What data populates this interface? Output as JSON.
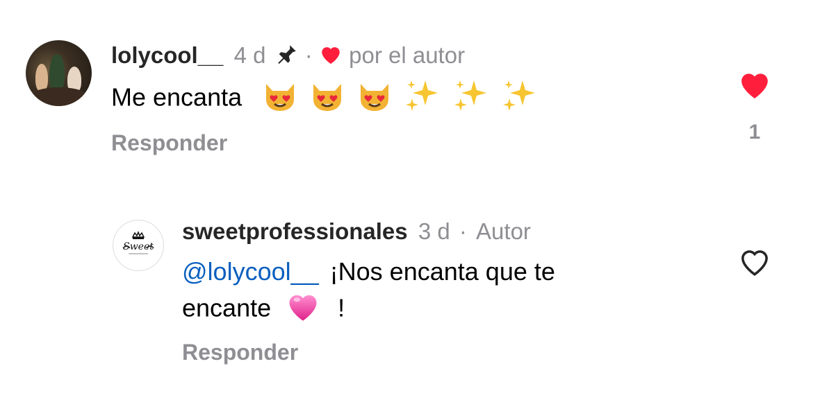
{
  "comments": [
    {
      "username": "lolycool__",
      "time": "4 d",
      "separator": "·",
      "liked_by_author_label": "por el autor",
      "text": "Me encanta",
      "emojis": [
        "heart-eyes-cat",
        "heart-eyes-cat",
        "heart-eyes-cat",
        "sparkles",
        "sparkles",
        "sparkles"
      ],
      "reply_label": "Responder",
      "like_count": "1",
      "liked": true
    },
    {
      "username": "sweetprofessionales",
      "time": "3 d",
      "separator": "·",
      "author_label": "Autor",
      "mention": "@lolycool__",
      "text_line1": "¡Nos encanta que te",
      "text_line2": "encante",
      "text_end": "!",
      "emoji": "pink-heart",
      "reply_label": "Responder",
      "liked": false
    }
  ],
  "colors": {
    "like_red": "#ff1e3c",
    "mention_blue": "#0a5fbf",
    "muted_gray": "#8e8e93"
  }
}
